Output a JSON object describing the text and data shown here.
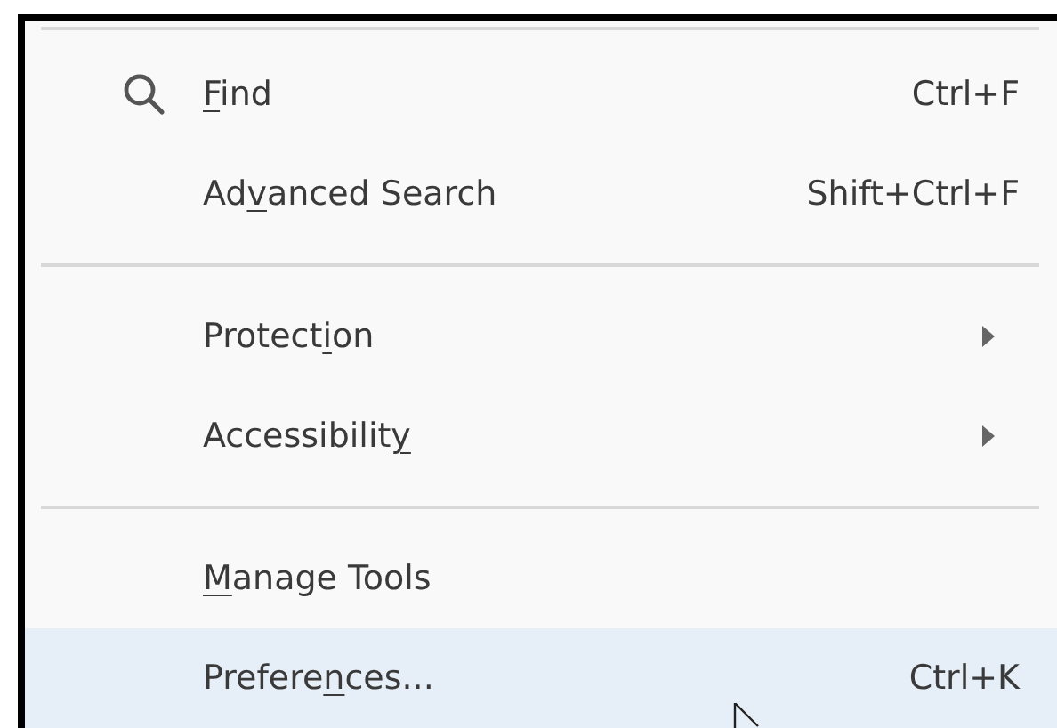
{
  "menu": {
    "items": [
      {
        "kind": "search_command",
        "access_key": "F",
        "label_after": "ind",
        "shortcut": "Ctrl+F",
        "selected": false
      },
      {
        "kind": "command",
        "label_before": "Ad",
        "access_key": "v",
        "label_after": "anced Search",
        "shortcut": "Shift+Ctrl+F",
        "selected": false
      },
      {
        "kind": "separator"
      },
      {
        "kind": "submenu",
        "label_before": "Protect",
        "access_key": "i",
        "label_after": "on",
        "selected": false
      },
      {
        "kind": "submenu",
        "label_before": "Accessibilit",
        "access_key": "y",
        "selected": false
      },
      {
        "kind": "separator"
      },
      {
        "kind": "command",
        "access_key": "M",
        "label_after": "anage Tools",
        "selected": false
      },
      {
        "kind": "command",
        "label_before": "Prefere",
        "access_key": "n",
        "label_after": "ces...",
        "shortcut": "Ctrl+K",
        "selected": true
      }
    ]
  }
}
